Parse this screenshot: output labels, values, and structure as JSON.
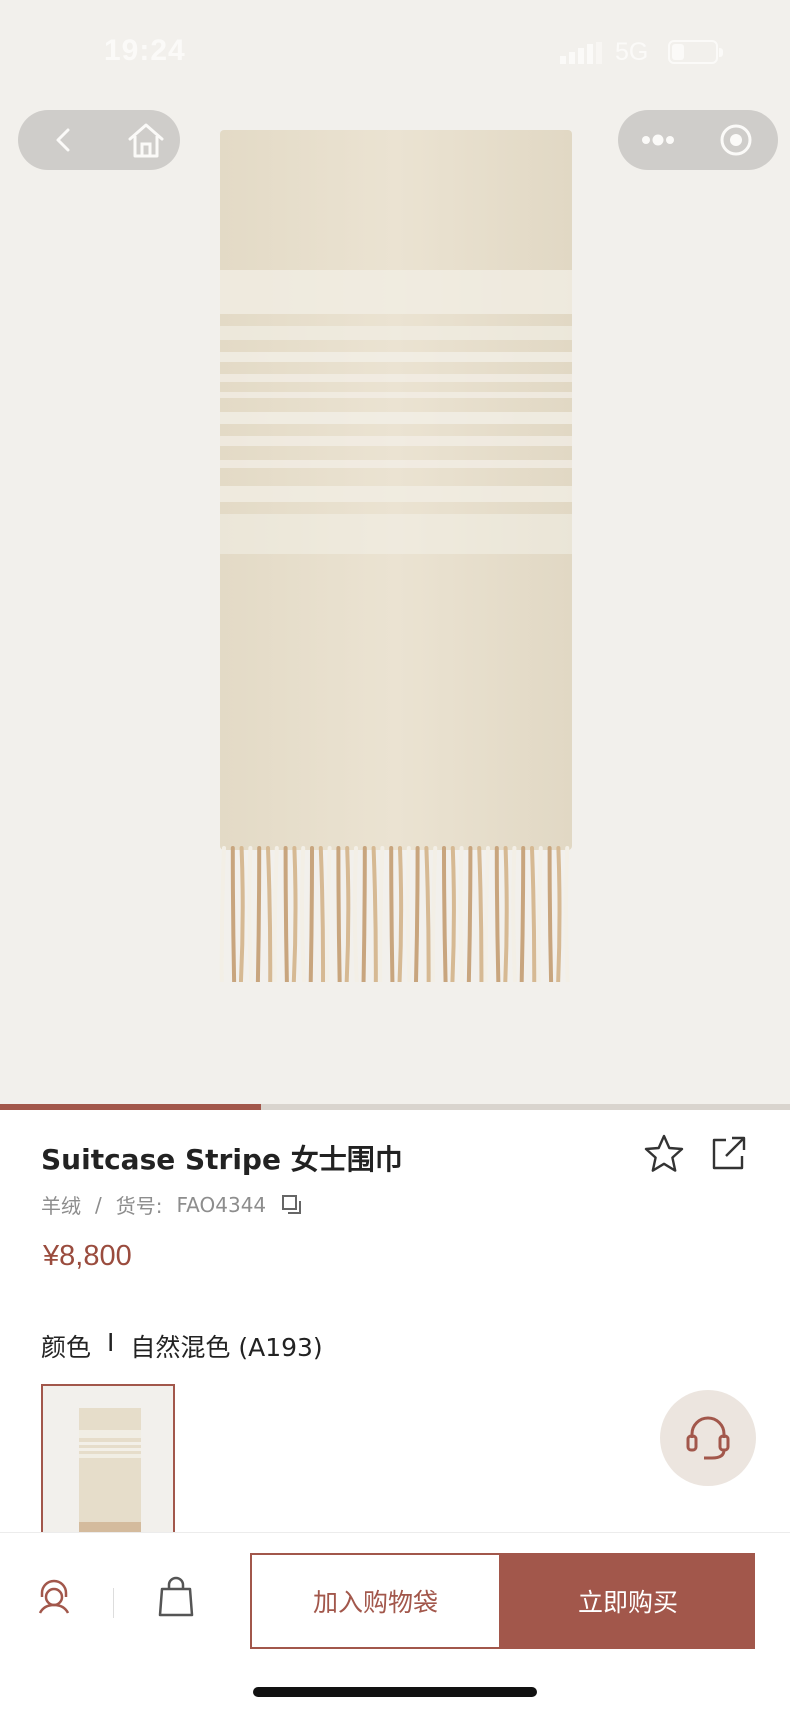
{
  "status_bar": {
    "time": "19:24",
    "network": "5G"
  },
  "product": {
    "title": "Suitcase Stripe 女士围巾",
    "material": "羊绒",
    "separator": "/",
    "sku_label": "货号:",
    "sku": "FAO4344",
    "price": "¥8,800",
    "color_label": "颜色",
    "color_separator": "I",
    "color_value": "自然混色 (A193)"
  },
  "gallery": {
    "progress": 0.33
  },
  "actions": {
    "add_to_bag": "加入购物袋",
    "buy_now": "立即购买"
  },
  "colors": {
    "accent": "#a2574b",
    "price": "#9a4c3e",
    "hero_bg": "#f2f0ec",
    "scarf": "#e6ddca",
    "stripe": "#eeebe1",
    "fringe": "#c8a57e"
  },
  "icons": {
    "back": "chevron-left-icon",
    "home": "home-icon",
    "more": "more-dots-icon",
    "close": "target-circle-icon",
    "favorite": "star-icon",
    "share": "share-icon",
    "copy": "copy-icon",
    "customer_service": "headset-icon",
    "bag": "shopping-bag-icon"
  }
}
